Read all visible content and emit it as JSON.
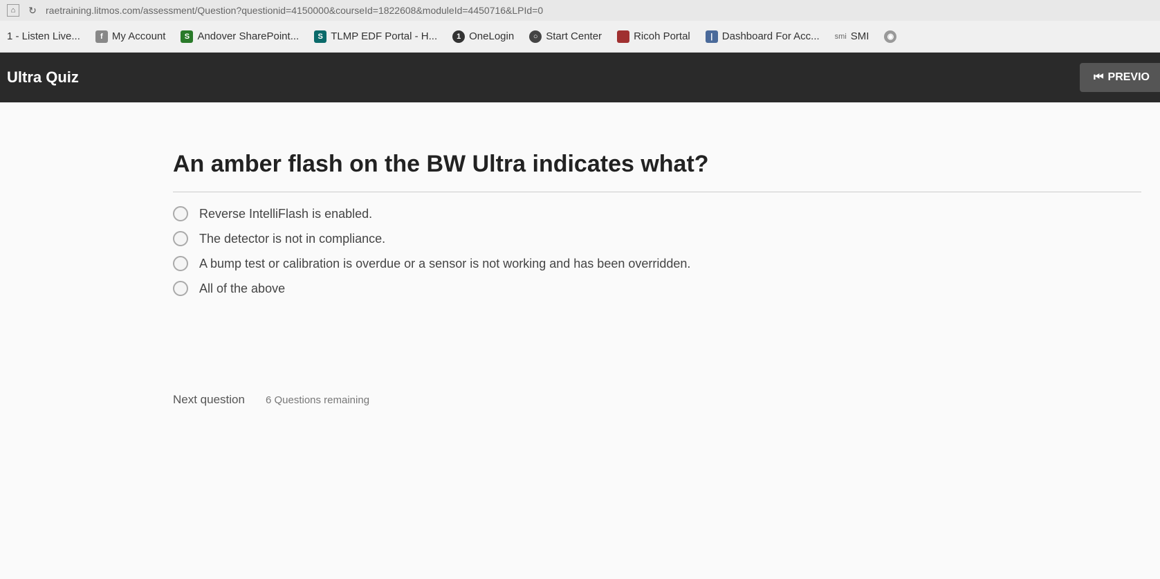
{
  "url_bar": {
    "url": "raetraining.litmos.com/assessment/Question?questionid=4150000&courseId=1822608&moduleId=4450716&LPId=0"
  },
  "bookmarks": [
    {
      "label": "1 - Listen Live...",
      "icon_class": "bk-plain"
    },
    {
      "label": "My Account",
      "icon_class": "bk-plain"
    },
    {
      "label": "Andover SharePoint...",
      "icon_class": "bk-green"
    },
    {
      "label": "TLMP EDF Portal - H...",
      "icon_class": "bk-teal"
    },
    {
      "label": "OneLogin",
      "icon_class": "bk-dark"
    },
    {
      "label": "Start Center",
      "icon_class": "bk-darkgrey"
    },
    {
      "label": "Ricoh Portal",
      "icon_class": "bk-red"
    },
    {
      "label": "Dashboard For Acc...",
      "icon_class": "bk-blue"
    },
    {
      "label": "SMI",
      "icon_class": "bk-plain",
      "prefix": "smi"
    },
    {
      "label": "",
      "icon_class": "bk-grey"
    }
  ],
  "header": {
    "title": "Ultra Quiz",
    "prev_label": "PREVIO"
  },
  "quiz": {
    "question": "An amber flash on the BW Ultra indicates what?",
    "options": [
      "Reverse IntelliFlash is enabled.",
      "The detector is not in compliance.",
      "A bump test or calibration is overdue or a sensor is not working and has been overridden.",
      "All of the above"
    ],
    "next_label": "Next question",
    "remaining_label": "6 Questions remaining"
  }
}
